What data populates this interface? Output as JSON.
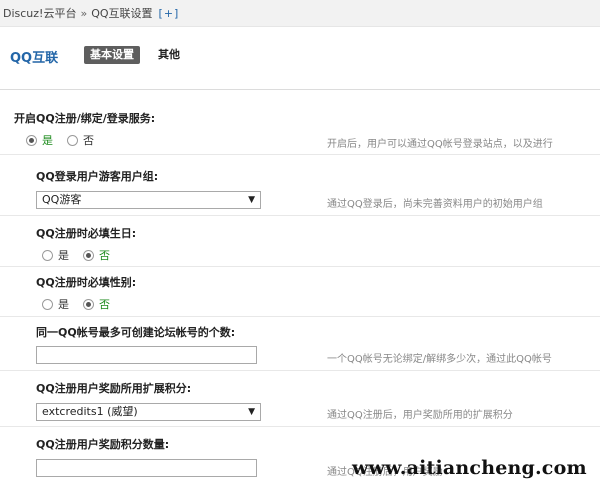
{
  "breadcrumb": {
    "root": "Discuz!云平台",
    "separator": "»",
    "current": "QQ互联设置",
    "add": "[+]"
  },
  "header": {
    "app_title": "QQ互联",
    "tab_active": "基本设置",
    "tab_other": "其他"
  },
  "settings": {
    "service": {
      "label": "开启QQ注册/绑定/登录服务:",
      "opt_yes": "是",
      "opt_no": "否",
      "selected": "是",
      "hint": "开启后，用户可以通过QQ帐号登录站点，以及进行"
    },
    "guest_group": {
      "label": "QQ登录用户游客用户组:",
      "value": "QQ游客",
      "hint": "通过QQ登录后，尚未完善资料用户的初始用户组"
    },
    "birthday": {
      "label": "QQ注册时必填生日:",
      "opt_yes": "是",
      "opt_no": "否",
      "selected": "否"
    },
    "gender": {
      "label": "QQ注册时必填性别:",
      "opt_yes": "是",
      "opt_no": "否",
      "selected": "否"
    },
    "max_accounts": {
      "label": "同一QQ帐号最多可创建论坛帐号的个数:",
      "value": "",
      "hint": "一个QQ帐号无论绑定/解绑多少次，通过此QQ帐号"
    },
    "reward_credit": {
      "label": "QQ注册用户奖励所用扩展积分:",
      "value": "extcredits1 (威望)",
      "hint": "通过QQ注册后，用户奖励所用的扩展积分"
    },
    "reward_amount": {
      "label": "QQ注册用户奖励积分数量:",
      "value": "",
      "hint": "通过QQ注册后，用户奖励"
    }
  },
  "watermark": "www.aitiancheng.com",
  "icons": {
    "select_arrow": "chevron-down-icon"
  }
}
